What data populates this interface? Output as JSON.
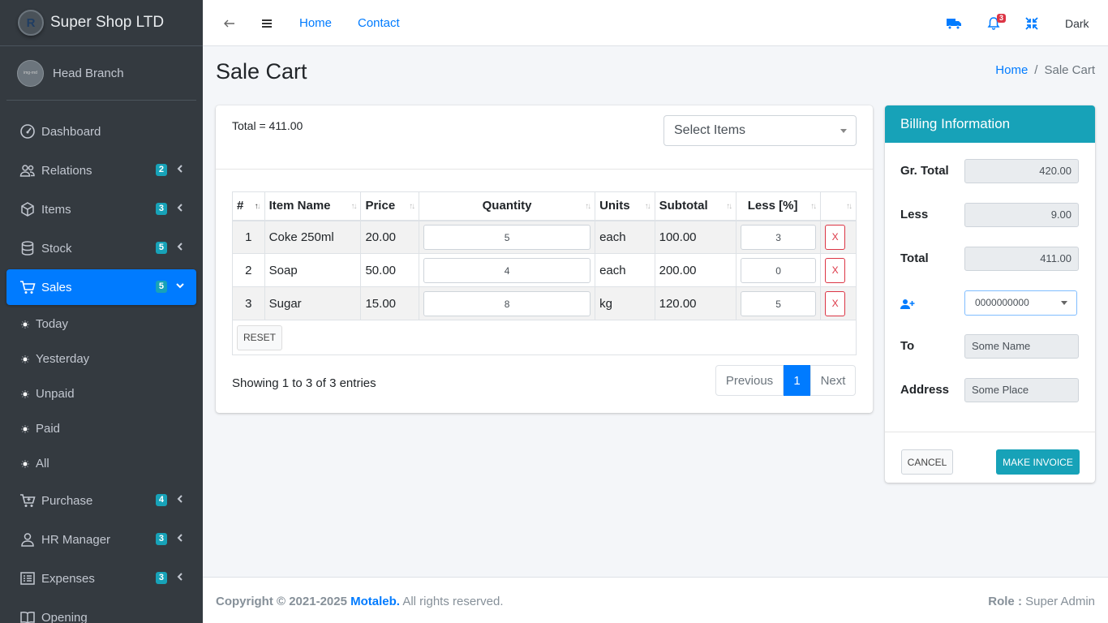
{
  "brand": {
    "name": "Super Shop LTD",
    "logo_letter": "R"
  },
  "user_panel": {
    "branch": "Head Branch",
    "avatar_text": "img-rnd"
  },
  "sidebar": {
    "items": [
      {
        "label": "Dashboard",
        "icon": "dashboard-icon"
      },
      {
        "label": "Relations",
        "icon": "users-icon",
        "badge": "2"
      },
      {
        "label": "Items",
        "icon": "box-icon",
        "badge": "3"
      },
      {
        "label": "Stock",
        "icon": "database-icon",
        "badge": "5"
      },
      {
        "label": "Sales",
        "icon": "cart-icon",
        "badge": "5",
        "active": true
      },
      {
        "label": "Purchase",
        "icon": "cart-plus-icon",
        "badge": "4"
      },
      {
        "label": "HR Manager",
        "icon": "user-icon",
        "badge": "3"
      },
      {
        "label": "Expenses",
        "icon": "list-icon",
        "badge": "3"
      },
      {
        "label": "Opening",
        "icon": "book-icon"
      }
    ],
    "sales_sub": [
      "Today",
      "Yesterday",
      "Unpaid",
      "Paid",
      "All"
    ]
  },
  "topbar": {
    "home": "Home",
    "contact": "Contact",
    "notif_count": "3",
    "theme": "Dark"
  },
  "page": {
    "title": "Sale Cart",
    "breadcrumb": {
      "home": "Home",
      "current": "Sale Cart"
    }
  },
  "cart": {
    "total_text": "Total = 411.00",
    "select_placeholder": "Select Items",
    "columns": [
      "#",
      "Item Name",
      "Price",
      "Quantity",
      "Units",
      "Subtotal",
      "Less [%]",
      ""
    ],
    "rows": [
      {
        "n": "1",
        "name": "Coke 250ml",
        "price": "20.00",
        "qty": "5",
        "unit": "each",
        "subtotal": "100.00",
        "less": "3",
        "remove": "X"
      },
      {
        "n": "2",
        "name": "Soap",
        "price": "50.00",
        "qty": "4",
        "unit": "each",
        "subtotal": "200.00",
        "less": "0",
        "remove": "X"
      },
      {
        "n": "3",
        "name": "Sugar",
        "price": "15.00",
        "qty": "8",
        "unit": "kg",
        "subtotal": "120.00",
        "less": "5",
        "remove": "X"
      }
    ],
    "reset_label": "RESET",
    "showing": "Showing 1 to 3 of 3 entries",
    "pagination": {
      "prev": "Previous",
      "current": "1",
      "next": "Next"
    }
  },
  "billing": {
    "title": "Billing Information",
    "gr_total_label": "Gr. Total",
    "gr_total": "420.00",
    "less_label": "Less",
    "less": "9.00",
    "total_label": "Total",
    "total": "411.00",
    "customer_select": "0000000000",
    "to_label": "To",
    "to_value": "Some Name",
    "address_label": "Address",
    "address_value": "Some Place",
    "cancel_label": "CANCEL",
    "invoice_label": "MAKE INVOICE"
  },
  "footer": {
    "copyright": "Copyright © 2021-2025",
    "author": "Motaleb.",
    "rights": "All rights reserved.",
    "role_label": "Role :",
    "role_value": "Super Admin"
  },
  "colors": {
    "primary": "#007bff",
    "info": "#17a2b8",
    "danger": "#dc3545",
    "sidebar": "#343a40"
  }
}
